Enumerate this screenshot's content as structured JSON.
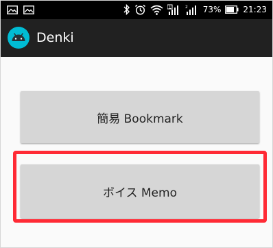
{
  "status_bar": {
    "left_icons": [
      "image-notification-icon",
      "image-notification-icon"
    ],
    "battery_percent": "73%",
    "time": "21:23",
    "icons": [
      "bluetooth-icon",
      "alarm-icon",
      "wifi-icon",
      "signal-sim1-icon",
      "signal-sim2-icon",
      "battery-icon"
    ]
  },
  "app_bar": {
    "title": "Denki",
    "icon": "android-icon"
  },
  "buttons": [
    {
      "label": "簡易 Bookmark"
    },
    {
      "label": "ボイス Memo"
    }
  ],
  "colors": {
    "status_bar": "#000000",
    "app_bar": "#212121",
    "app_icon_circle": "#00bcd4",
    "button": "#d6d6d6",
    "highlight": "#ff2a35"
  }
}
